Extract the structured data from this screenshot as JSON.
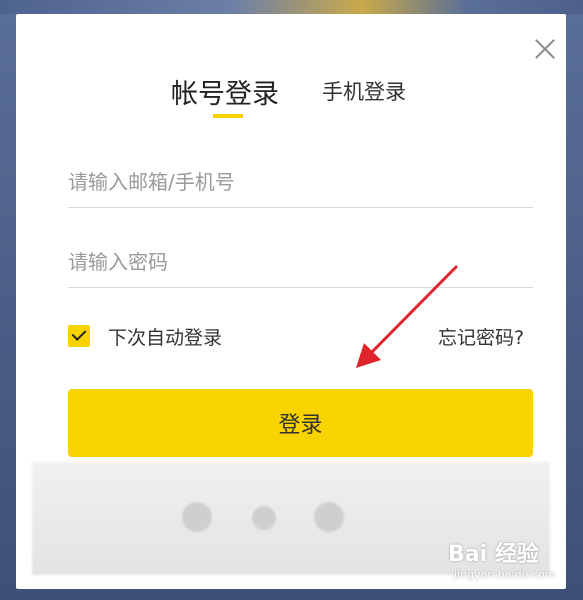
{
  "modal": {
    "tabs": [
      {
        "label": "帐号登录",
        "active": true
      },
      {
        "label": "手机登录",
        "active": false
      }
    ],
    "email_placeholder": "请输入邮箱/手机号",
    "password_placeholder": "请输入密码",
    "remember_label": "下次自动登录",
    "remember_checked": true,
    "forgot_label": "忘记密码?",
    "login_label": "登录",
    "close_icon": "close-icon"
  },
  "watermark": {
    "logo": "Bai 经验",
    "url": "jingyan.baidu.com"
  },
  "colors": {
    "accent": "#f8d300",
    "annotation_arrow": "#e0242b",
    "background": "#4a5d86"
  }
}
